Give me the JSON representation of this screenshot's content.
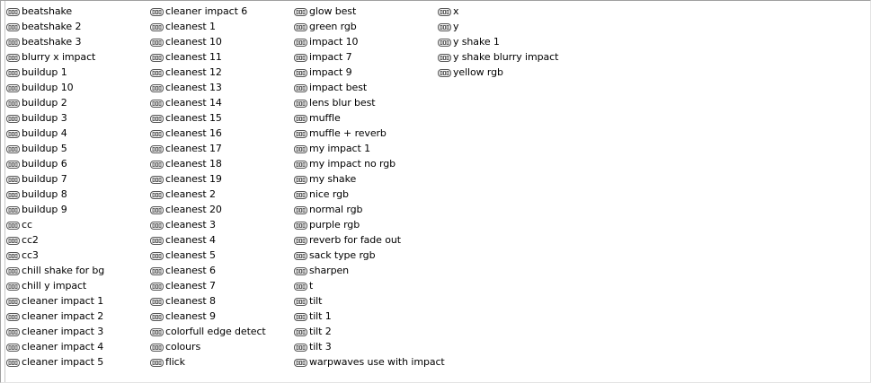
{
  "columns": [
    {
      "items": [
        "beatshake",
        "beatshake 2",
        "beatshake 3",
        "blurry x impact",
        "buildup 1",
        "buildup 10",
        "buildup 2",
        "buildup 3",
        "buildup 4",
        "buildup 5",
        "buildup 6",
        "buildup 7",
        "buildup 8",
        "buildup 9",
        "cc",
        "cc2",
        "cc3",
        "chill shake for bg",
        "chill y impact",
        "cleaner impact 1",
        "cleaner impact 2",
        "cleaner impact 3",
        "cleaner impact 4",
        "cleaner impact 5"
      ]
    },
    {
      "items": [
        "cleaner impact 6",
        "cleanest 1",
        "cleanest 10",
        "cleanest 11",
        "cleanest 12",
        "cleanest 13",
        "cleanest 14",
        "cleanest 15",
        "cleanest 16",
        "cleanest 17",
        "cleanest 18",
        "cleanest 19",
        "cleanest 2",
        "cleanest 20",
        "cleanest 3",
        "cleanest 4",
        "cleanest 5",
        "cleanest 6",
        "cleanest 7",
        "cleanest 8",
        "cleanest 9",
        "colorfull edge detect",
        "colours",
        "flick"
      ]
    },
    {
      "items": [
        "glow best",
        "green rgb",
        "impact 10",
        "impact 7",
        "impact 9",
        "impact best",
        "lens blur best",
        "muffle",
        "muffle + reverb",
        "my impact 1",
        "my impact no rgb",
        "my shake",
        "nice rgb",
        "normal rgb",
        "purple rgb",
        "reverb for fade out",
        "sack type rgb",
        "sharpen",
        "t",
        "tilt",
        "tilt 1",
        "tilt 2",
        "tilt 3",
        "warpwaves use with impact"
      ]
    },
    {
      "items": [
        "x",
        "y",
        "y shake 1",
        "y shake blurry impact",
        "yellow rgb"
      ]
    }
  ],
  "item_icon": "preset-file-icon",
  "colors": {
    "background": "#ffffff",
    "text": "#000000",
    "icon_stroke": "#444444",
    "border": "#a0a0a0"
  }
}
